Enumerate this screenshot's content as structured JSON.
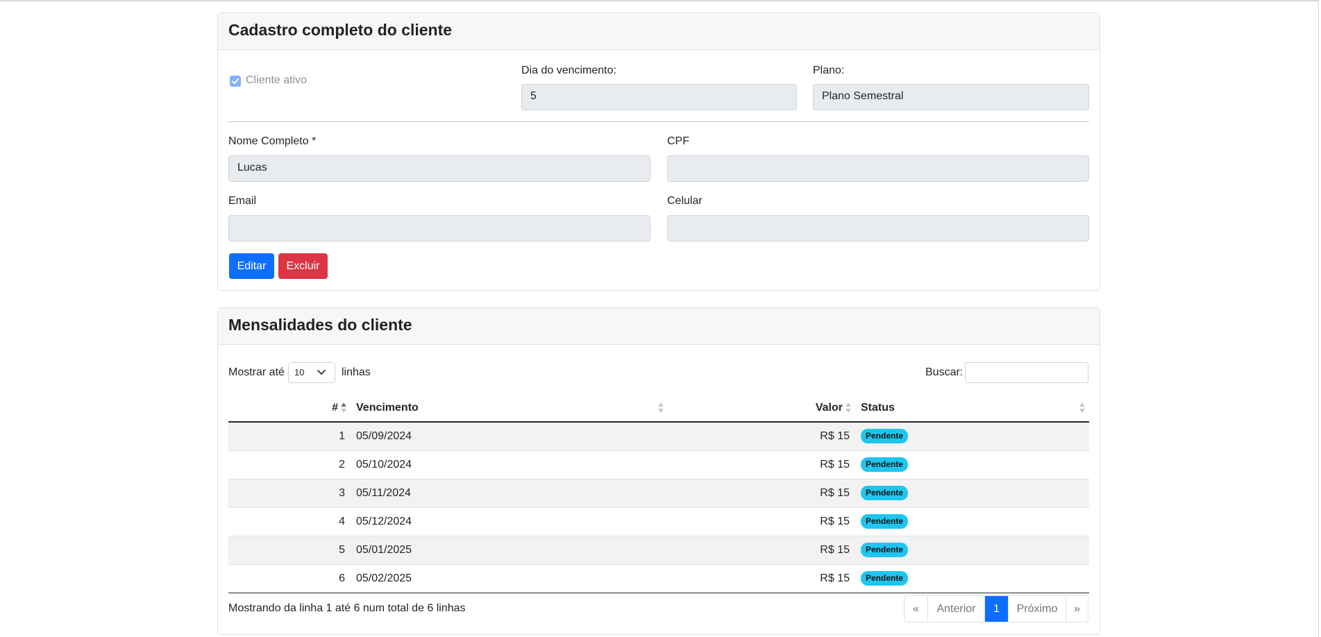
{
  "client_card": {
    "title": "Cadastro completo do cliente",
    "active_label": "Cliente ativo",
    "due_day_label": "Dia do vencimento:",
    "due_day_value": "5",
    "plan_label": "Plano:",
    "plan_value": "Plano Semestral",
    "name_label": "Nome Completo *",
    "name_value": "Lucas",
    "cpf_label": "CPF",
    "cpf_value": "",
    "email_label": "Email",
    "email_value": "",
    "phone_label": "Celular",
    "phone_value": "",
    "edit_label": "Editar",
    "delete_label": "Excluir"
  },
  "payments_card": {
    "title": "Mensalidades do cliente",
    "show_prefix": "Mostrar até",
    "show_value": "10",
    "show_suffix": "linhas",
    "search_label": "Buscar:",
    "columns": [
      "#",
      "Vencimento",
      "Valor",
      "Status"
    ],
    "rows": [
      {
        "n": "1",
        "due": "05/09/2024",
        "value": "R$ 15",
        "status": "Pendente"
      },
      {
        "n": "2",
        "due": "05/10/2024",
        "value": "R$ 15",
        "status": "Pendente"
      },
      {
        "n": "3",
        "due": "05/11/2024",
        "value": "R$ 15",
        "status": "Pendente"
      },
      {
        "n": "4",
        "due": "05/12/2024",
        "value": "R$ 15",
        "status": "Pendente"
      },
      {
        "n": "5",
        "due": "05/01/2025",
        "value": "R$ 15",
        "status": "Pendente"
      },
      {
        "n": "6",
        "due": "05/02/2025",
        "value": "R$ 15",
        "status": "Pendente"
      }
    ],
    "info": "Mostrando da linha 1 até 6 num total de 6 linhas",
    "pagination": {
      "first": "«",
      "prev": "Anterior",
      "page": "1",
      "next": "Próximo",
      "last": "»"
    }
  },
  "colors": {
    "primary": "#0d6efd",
    "danger": "#dc3545",
    "badge": "#1ec6ef"
  },
  "icons": {
    "checkbox": "check-icon",
    "select": "chevron-down-icon",
    "sort": "sort-icon"
  }
}
